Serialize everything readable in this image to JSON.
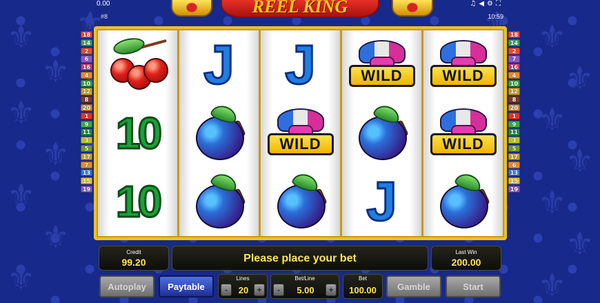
{
  "top": {
    "credit_small": "0.00",
    "game_id": "#8",
    "clock": "10:59",
    "icons": [
      "music-note-icon",
      "volume-icon",
      "settings-icon",
      "fullscreen-icon"
    ]
  },
  "logo": {
    "title": "REEL KING"
  },
  "line_numbers_left": [
    "18",
    "14",
    "2",
    "6",
    "16",
    "4",
    "10",
    "12",
    "8",
    "20",
    "1",
    "9",
    "11",
    "3",
    "5",
    "17",
    "7",
    "13",
    "15",
    "19"
  ],
  "line_numbers_right": [
    "18",
    "14",
    "2",
    "7",
    "16",
    "4",
    "10",
    "12",
    "8",
    "20",
    "1",
    "9",
    "11",
    "3",
    "5",
    "17",
    "6",
    "13",
    "15",
    "19"
  ],
  "line_colors": [
    "#e84a32",
    "#3aa94c",
    "#e84a32",
    "#8c57c7",
    "#c73a7a",
    "#e88a2a",
    "#3aa94c",
    "#c7a21f",
    "#7a3a2a",
    "#d28f40",
    "#e8321e",
    "#3aa94c",
    "#1e8a4a",
    "#b8c220",
    "#6a9a2a",
    "#c7a21f",
    "#e88a2a",
    "#3a7ad8",
    "#e8c21f",
    "#8c57c7"
  ],
  "reels": [
    [
      "cherry",
      "ten",
      "ten"
    ],
    [
      "jack",
      "plum",
      "plum"
    ],
    [
      "jack",
      "wild",
      "plum"
    ],
    [
      "wild",
      "plum",
      "jack"
    ],
    [
      "wild",
      "wild",
      "plum"
    ]
  ],
  "symbol_text": {
    "jack": "J",
    "ten": "10",
    "wild": "WILD"
  },
  "info": {
    "credit_label": "Credit",
    "credit_value": "99.20",
    "message": "Please place your bet",
    "last_win_label": "Last Win",
    "last_win_value": "200.00"
  },
  "controls": {
    "autoplay": "Autoplay",
    "paytable": "Paytable",
    "lines_label": "Lines",
    "lines_value": "20",
    "bet_line_label": "Bet/Line",
    "bet_line_value": "5.00",
    "bet_label": "Bet",
    "bet_value": "100.00",
    "gamble": "Gamble",
    "start": "Start",
    "minus": "-",
    "plus": "+"
  },
  "colors": {
    "background": "#17298a",
    "frame": "#f0c020",
    "value_text": "#ffe45a"
  }
}
